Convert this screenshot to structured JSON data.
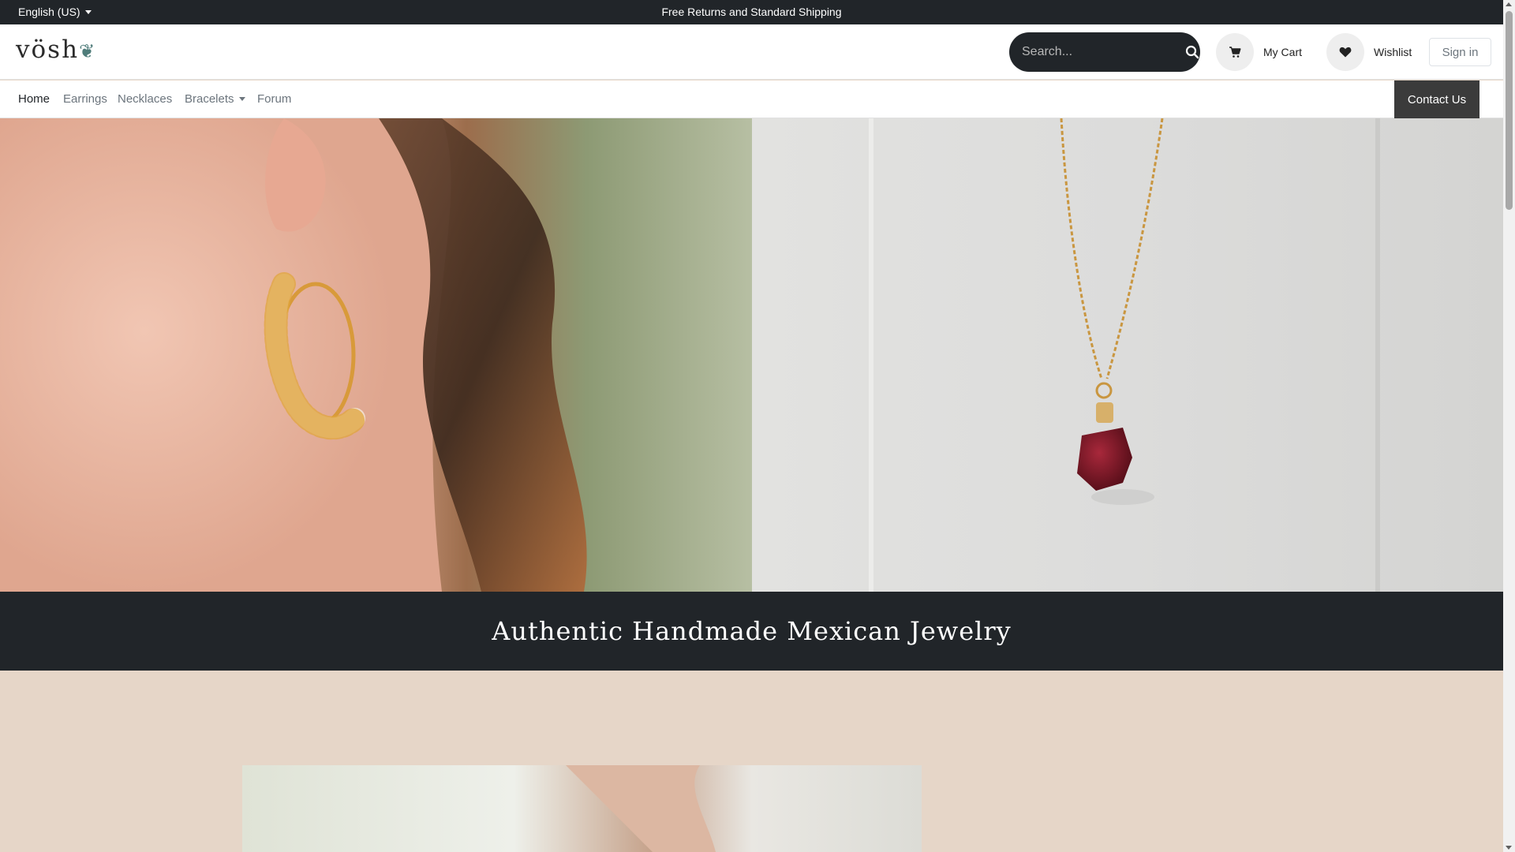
{
  "topbar": {
    "language": "English (US)",
    "announcement": "Free Returns and Standard Shipping"
  },
  "header": {
    "logo_text": "vösh",
    "logo_mark": "ë",
    "search_placeholder": "Search...",
    "cart_label": "My Cart",
    "wishlist_label": "Wishlist",
    "signin_label": "Sign in"
  },
  "nav": {
    "items": [
      {
        "label": "Home",
        "active": true
      },
      {
        "label": "Earrings"
      },
      {
        "label": "Necklaces"
      },
      {
        "label": "Bracelets",
        "dropdown": true
      },
      {
        "label": "Forum"
      }
    ],
    "contact_label": "Contact Us"
  },
  "hero": {
    "left_image": "woman wearing beaded gold hoop earring",
    "right_image": "gold chain necklace with red garnet pendant"
  },
  "banner": {
    "title": "Authentic Handmade Mexican Jewelry"
  },
  "colors": {
    "dark": "#212529",
    "section_bg": "#e6d6c8",
    "contact_bg": "#3b3b3b"
  }
}
